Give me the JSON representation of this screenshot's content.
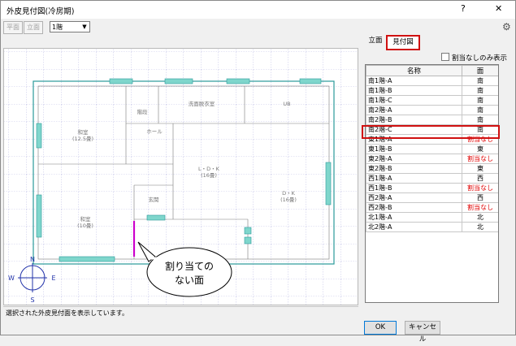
{
  "window": {
    "title": "外皮見付図(冷房期)",
    "help_label": "?",
    "close_label": "✕"
  },
  "toolbar": {
    "plan_label": "平面",
    "elevation_label": "立面",
    "floor_select_value": "1階"
  },
  "tabs": [
    {
      "label": "立面",
      "active": false
    },
    {
      "label": "見付図",
      "active": true
    }
  ],
  "filter": {
    "label": "割当なしのみ表示",
    "checked": false
  },
  "table": {
    "headers": [
      "名称",
      "面"
    ],
    "rows": [
      {
        "name": "南1階-A",
        "face": "南",
        "unassigned": false
      },
      {
        "name": "南1階-B",
        "face": "南",
        "unassigned": false
      },
      {
        "name": "南1階-C",
        "face": "南",
        "unassigned": false
      },
      {
        "name": "南2階-A",
        "face": "南",
        "unassigned": false
      },
      {
        "name": "南2階-B",
        "face": "南",
        "unassigned": false
      },
      {
        "name": "南2階-C",
        "face": "南",
        "unassigned": false
      },
      {
        "name": "東1階-A",
        "face": "割当なし",
        "unassigned": true,
        "selected": true
      },
      {
        "name": "東1階-B",
        "face": "東",
        "unassigned": false
      },
      {
        "name": "東2階-A",
        "face": "割当なし",
        "unassigned": true
      },
      {
        "name": "東2階-B",
        "face": "東",
        "unassigned": false
      },
      {
        "name": "西1階-A",
        "face": "西",
        "unassigned": false
      },
      {
        "name": "西1階-B",
        "face": "割当なし",
        "unassigned": true
      },
      {
        "name": "西2階-A",
        "face": "西",
        "unassigned": false
      },
      {
        "name": "西2階-B",
        "face": "割当なし",
        "unassigned": true
      },
      {
        "name": "北1階-A",
        "face": "北",
        "unassigned": false
      },
      {
        "name": "北2階-A",
        "face": "北",
        "unassigned": false
      }
    ]
  },
  "floor_plan": {
    "rooms": [
      {
        "name": "和室",
        "sub": "(12.5畳)"
      },
      {
        "name": "階段"
      },
      {
        "name": "洗面脱衣室"
      },
      {
        "name": "UB"
      },
      {
        "name": "ホール"
      },
      {
        "name": "L・D・K",
        "sub": "(16畳)"
      },
      {
        "name": "D・K",
        "sub": "(16畳)"
      },
      {
        "name": "和室",
        "sub": "(10畳)"
      },
      {
        "name": "玄関"
      }
    ],
    "compass": {
      "n": "N",
      "s": "S",
      "e": "E",
      "w": "W"
    },
    "callout_line1": "割り当ての",
    "callout_line2": "ない面"
  },
  "status_text": "選択された外皮見付面を表示しています。",
  "buttons": {
    "ok": "OK",
    "cancel": "キャンセル"
  },
  "colors": {
    "accent_red": "#d01010",
    "wall_teal": "#2a9a9a",
    "window_teal": "#7fd6cc",
    "unassigned_magenta": "#cc00cc"
  }
}
